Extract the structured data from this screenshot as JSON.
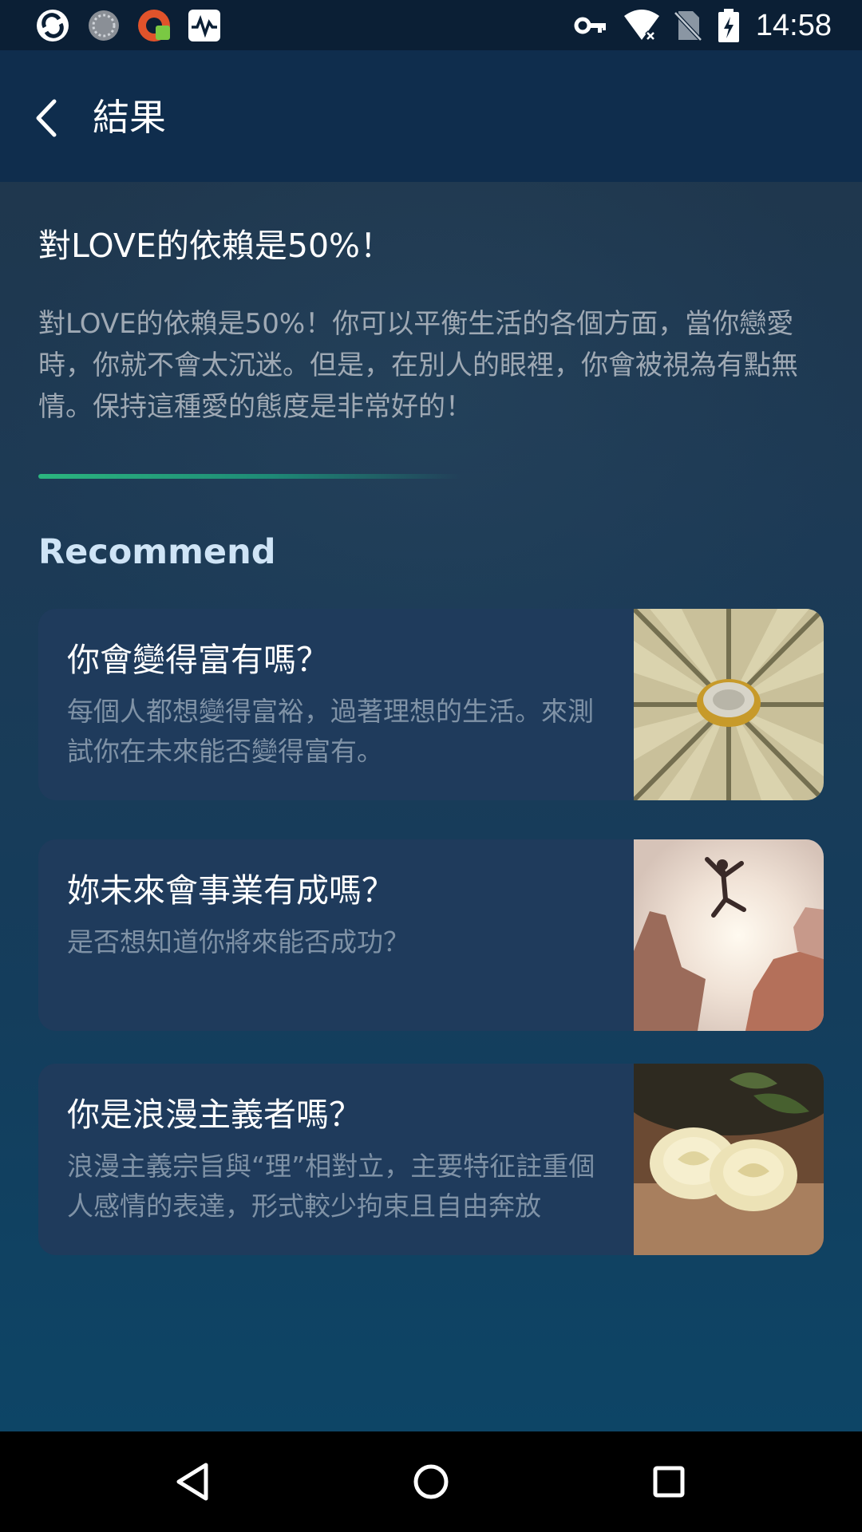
{
  "status_bar": {
    "time": "14:58",
    "left_icons": [
      "app-logo-icon",
      "spinner-icon",
      "vpn-app-icon",
      "activity-monitor-icon"
    ],
    "right_icons": [
      "vpn-key-icon",
      "wifi-icon",
      "no-sim-icon",
      "battery-charging-icon"
    ]
  },
  "toolbar": {
    "title": "結果"
  },
  "result": {
    "title": "對LOVE的依賴是50%！",
    "description": "對LOVE的依賴是50%！你可以平衡生活的各個方面，當你戀愛時，你就不會太沉迷。但是，在別人的眼裡，你會被視為有點無情。保持這種愛的態度是非常好的！"
  },
  "recommend": {
    "heading": "Recommend",
    "cards": [
      {
        "title": "你會變得富有嗎？",
        "description": "每個人都想變得富裕，過著理想的生活。來測試你在未來能否變得富有。",
        "image": "coin-on-banknotes"
      },
      {
        "title": "妳未來會事業有成嗎？",
        "description": "是否想知道你將來能否成功？",
        "image": "person-jumping-between-rocks"
      },
      {
        "title": "你是浪漫主義者嗎？",
        "description": "浪漫主義宗旨與“理”相對立，主要特征註重個人感情的表達，形式較少拘束且自由奔放",
        "image": "white-roses"
      }
    ]
  },
  "colors": {
    "accent": "#2bb67f",
    "card_bg": "#1f3b5c",
    "toolbar_bg": "#0f2d4d"
  }
}
